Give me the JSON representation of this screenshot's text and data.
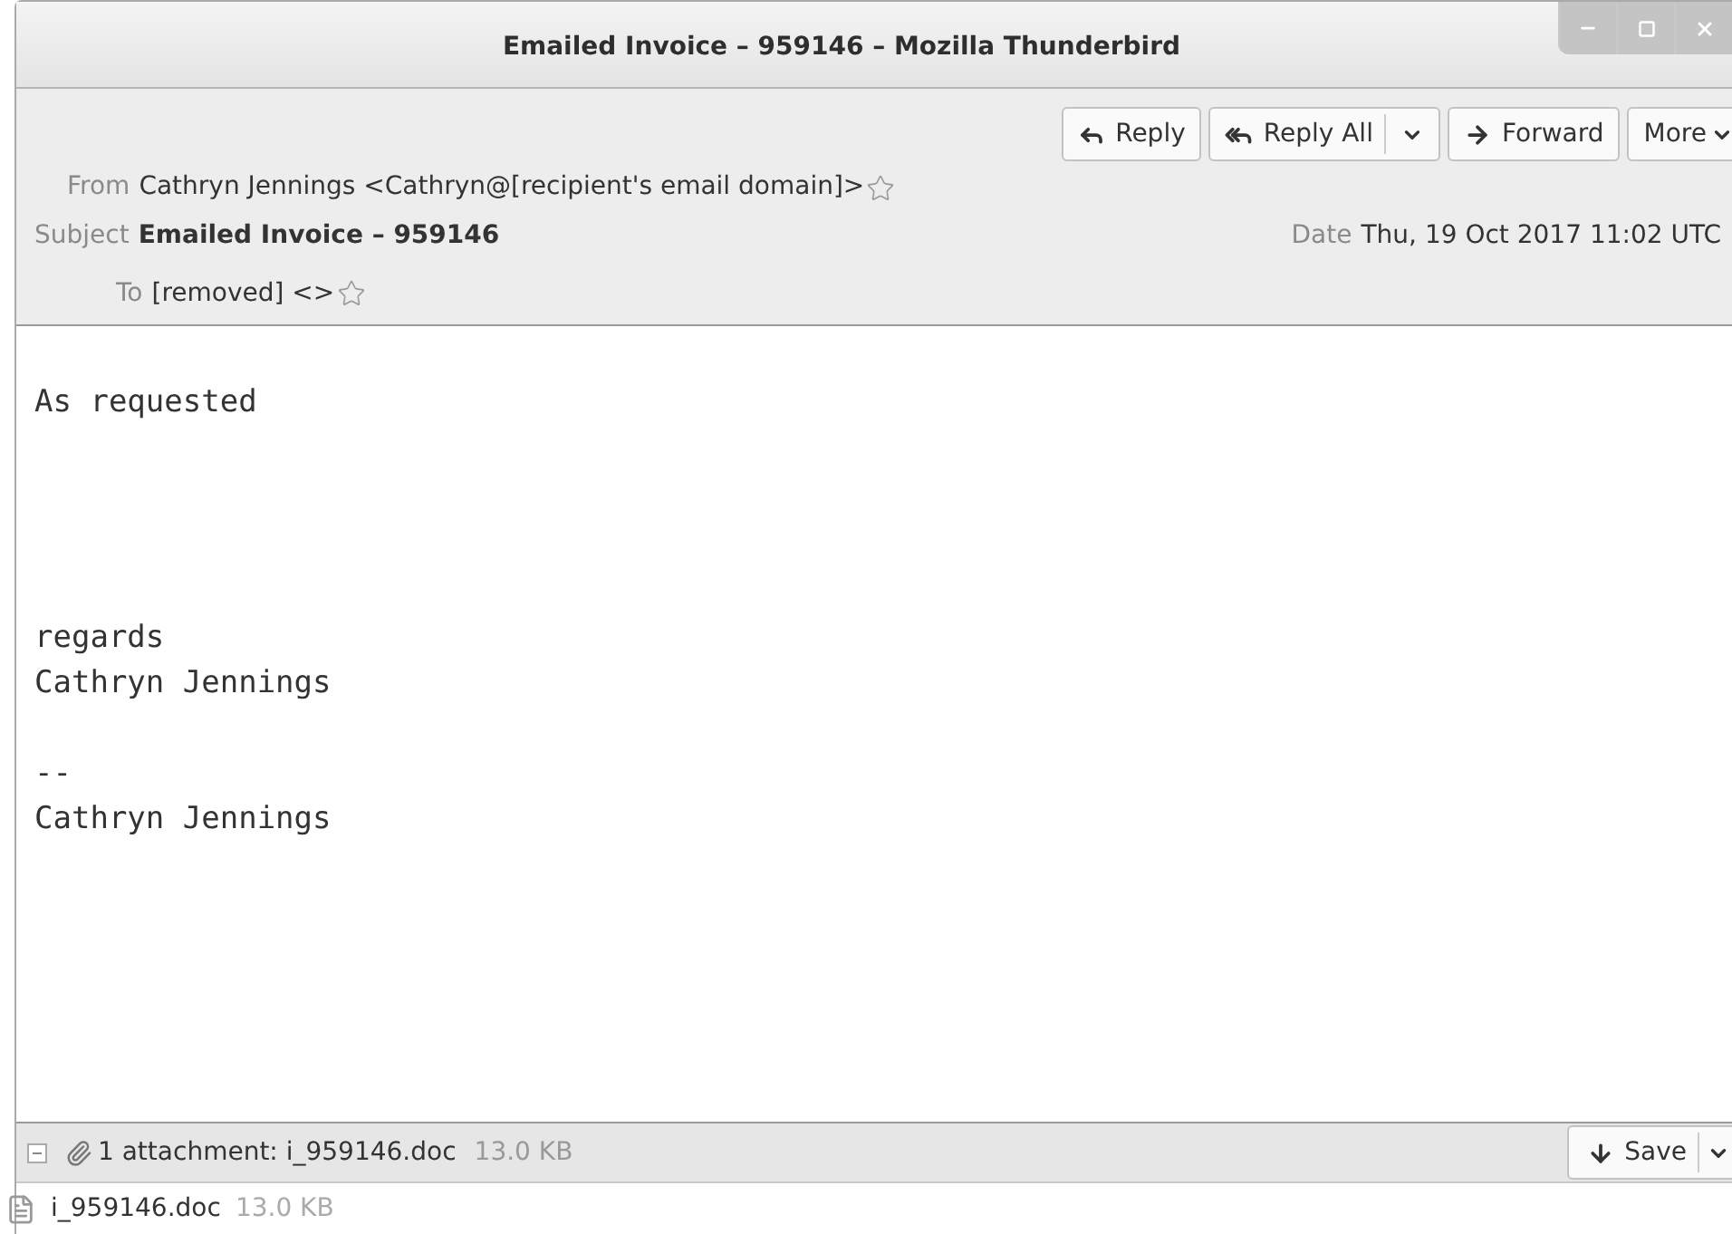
{
  "window": {
    "title": "Emailed Invoice – 959146 – Mozilla Thunderbird"
  },
  "toolbar": [
    {
      "label": "Reply",
      "kind": "reply",
      "dropdown": false
    },
    {
      "label": "Reply All",
      "kind": "reply-all",
      "dropdown": true
    },
    {
      "label": "Forward",
      "kind": "forward",
      "dropdown": false
    },
    {
      "label": "More",
      "kind": "more",
      "dropdown": true
    }
  ],
  "header": {
    "from": {
      "label": "From",
      "value": "Cathryn Jennings <Cathryn@[recipient's email domain]>"
    },
    "subject": {
      "label": "Subject",
      "value": "Emailed Invoice – 959146"
    },
    "date": {
      "label": "Date",
      "value": "Thu, 19 Oct 2017 11:02 UTC"
    },
    "to": {
      "label": "To",
      "value": "[removed] <>"
    }
  },
  "body": [
    [
      "As requested"
    ],
    [
      "regards",
      "Cathryn Jennings"
    ],
    [
      "--",
      "Cathryn Jennings"
    ]
  ],
  "attachment_bar": {
    "expanded": true,
    "summary": "1 attachment: i_959146.doc",
    "size": "13.0 KB",
    "save": "Save"
  },
  "attachments": [
    {
      "name": "i_959146.doc",
      "size": "13.0 KB"
    }
  ]
}
